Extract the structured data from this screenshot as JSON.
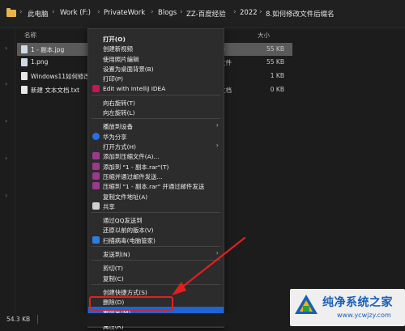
{
  "breadcrumb": [
    "此电脑",
    "Work (F:)",
    "PrivateWork",
    "Blogs",
    "ZZ-百度经验",
    "2022",
    "8.如何修改文件后缀名"
  ],
  "file_list": {
    "columns": {
      "name": "名称",
      "size": "大小"
    },
    "rows": [
      {
        "name": "1 - 副本.jpg",
        "type": "件",
        "size": "55 KB",
        "selected": true
      },
      {
        "name": "1.png",
        "type": "文件",
        "size": "55 KB",
        "selected": false
      },
      {
        "name": "Windows11如何修改文件...",
        "type": "",
        "size": "1 KB",
        "selected": false
      },
      {
        "name": "新建 文本文档.txt",
        "type": "文档",
        "size": "0 KB",
        "selected": false
      }
    ]
  },
  "context_menu": {
    "items": [
      {
        "label": "打开(O)",
        "bold": true
      },
      {
        "label": "创建新视频"
      },
      {
        "label": "使用照片编辑"
      },
      {
        "label": "设置为桌面背景(B)"
      },
      {
        "label": "打印(P)"
      },
      {
        "label": "Edit with IntelliJ IDEA",
        "icon": "intellij-icon"
      },
      {
        "sep": true
      },
      {
        "label": "向右旋转(T)"
      },
      {
        "label": "向左旋转(L)"
      },
      {
        "sep": true
      },
      {
        "label": "播放到设备",
        "submenu": true
      },
      {
        "label": "华为分享",
        "icon": "huawei-share-icon"
      },
      {
        "label": "打开方式(H)",
        "submenu": true
      },
      {
        "label": "添加到压缩文件(A)...",
        "icon": "winrar-icon"
      },
      {
        "label": "添加到 \"1 - 副本.rar\"(T)",
        "icon": "winrar-icon"
      },
      {
        "label": "压缩并通过邮件发送...",
        "icon": "winrar-icon"
      },
      {
        "label": "压缩到 \"1 - 副本.rar\" 并通过邮件发送",
        "icon": "winrar-icon"
      },
      {
        "label": "复制文件地址(A)"
      },
      {
        "label": "共享",
        "icon": "share-icon"
      },
      {
        "sep": true
      },
      {
        "label": "通过QQ发送到"
      },
      {
        "label": "还原以前的版本(V)"
      },
      {
        "label": "扫描病毒(电脑管家)",
        "icon": "pc-manager-icon"
      },
      {
        "sep": true
      },
      {
        "label": "发送到(N)",
        "submenu": true
      },
      {
        "sep": true
      },
      {
        "label": "剪切(T)"
      },
      {
        "label": "复制(C)"
      },
      {
        "sep": true
      },
      {
        "label": "创建快捷方式(S)"
      },
      {
        "label": "删除(D)"
      },
      {
        "label": "重命名(M)",
        "highlighted": true
      },
      {
        "sep": true
      },
      {
        "label": "属性(R)"
      }
    ]
  },
  "status_bar": {
    "size_text": "54.3 KB"
  },
  "watermark": {
    "title": "纯净系统之家",
    "url": "www.ycwjzy.com"
  },
  "colors": {
    "highlight": "#1e64d4",
    "annotation": "#e02020",
    "folder": "#e8b44a"
  }
}
